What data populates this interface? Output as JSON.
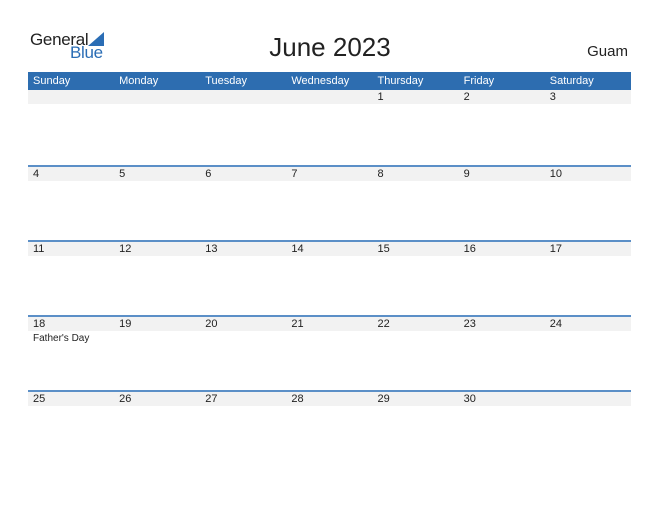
{
  "logo": {
    "word1": "General",
    "word2": "Blue"
  },
  "title": "June 2023",
  "region": "Guam",
  "colors": {
    "header_bg": "#2d6db0",
    "brand_blue": "#2a6db5",
    "row_shade": "#f2f2f2",
    "week_line": "#5b8fc7"
  },
  "weekdays": [
    "Sunday",
    "Monday",
    "Tuesday",
    "Wednesday",
    "Thursday",
    "Friday",
    "Saturday"
  ],
  "weeks": [
    [
      {
        "d": ""
      },
      {
        "d": ""
      },
      {
        "d": ""
      },
      {
        "d": ""
      },
      {
        "d": "1"
      },
      {
        "d": "2"
      },
      {
        "d": "3"
      }
    ],
    [
      {
        "d": "4"
      },
      {
        "d": "5"
      },
      {
        "d": "6"
      },
      {
        "d": "7"
      },
      {
        "d": "8"
      },
      {
        "d": "9"
      },
      {
        "d": "10"
      }
    ],
    [
      {
        "d": "11"
      },
      {
        "d": "12"
      },
      {
        "d": "13"
      },
      {
        "d": "14"
      },
      {
        "d": "15"
      },
      {
        "d": "16"
      },
      {
        "d": "17"
      }
    ],
    [
      {
        "d": "18",
        "event": "Father's Day"
      },
      {
        "d": "19"
      },
      {
        "d": "20"
      },
      {
        "d": "21"
      },
      {
        "d": "22"
      },
      {
        "d": "23"
      },
      {
        "d": "24"
      }
    ],
    [
      {
        "d": "25"
      },
      {
        "d": "26"
      },
      {
        "d": "27"
      },
      {
        "d": "28"
      },
      {
        "d": "29"
      },
      {
        "d": "30"
      },
      {
        "d": ""
      }
    ]
  ]
}
